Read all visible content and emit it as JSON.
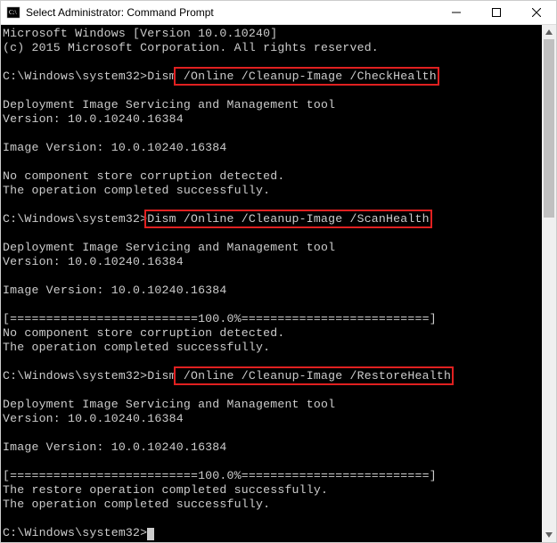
{
  "window": {
    "title": "Select Administrator: Command Prompt"
  },
  "terminal": {
    "line1": "Microsoft Windows [Version 10.0.10240]",
    "line2": "(c) 2015 Microsoft Corporation. All rights reserved.",
    "blank": "",
    "prompt": "C:\\Windows\\system32>",
    "dism": "Dism",
    "cmd1_rest": " /Online /Cleanup-Image /CheckHealth",
    "cmd2_full": "Dism /Online /Cleanup-Image /ScanHealth",
    "cmd3_rest": " /Online /Cleanup-Image /RestoreHealth",
    "tool_line1": "Deployment Image Servicing and Management tool",
    "tool_line2": "Version: 10.0.10240.16384",
    "img_ver": "Image Version: 10.0.10240.16384",
    "no_corrupt": "No component store corruption detected.",
    "op_success": "The operation completed successfully.",
    "progress": "[==========================100.0%==========================]",
    "restore_success": "The restore operation completed successfully.",
    "cursor_prompt": "C:\\Windows\\system32>"
  }
}
